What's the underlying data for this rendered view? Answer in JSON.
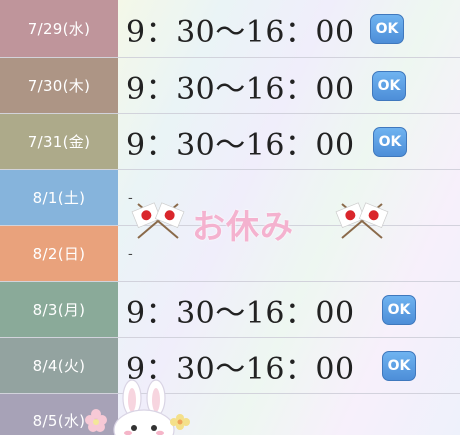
{
  "rows": [
    {
      "date": "7/29(水)",
      "hours": "9：30〜16：00",
      "status": "OK",
      "color": "#bf959b"
    },
    {
      "date": "7/30(木)",
      "hours": "9：30〜16：00",
      "status": "OK",
      "color": "#ad9585"
    },
    {
      "date": "7/31(金)",
      "hours": "9：30〜16：00",
      "status": "OK",
      "color": "#adaa8a"
    },
    {
      "date": "8/1(土)",
      "hours": "-",
      "color": "#86b4dc"
    },
    {
      "date": "8/2(日)",
      "hours": "-",
      "color": "#e9a27c"
    },
    {
      "date": "8/3(月)",
      "hours": "9：30〜16：00",
      "status": "OK",
      "color": "#8aaa99"
    },
    {
      "date": "8/4(火)",
      "hours": "9：30〜16：00",
      "status": "OK",
      "color": "#93a3a0"
    },
    {
      "date": "8/5(水)",
      "hours": "",
      "color": "#a7a2b7"
    }
  ],
  "holiday_label": "お休み",
  "colors": {
    "ok_badge": "#4d8ed8",
    "holiday_text": "#f4b2cf",
    "flag_red": "#d9262b"
  },
  "icons": [
    "ok-icon",
    "japan-flag-icon",
    "bunny-sticker-icon",
    "flower-icon"
  ]
}
